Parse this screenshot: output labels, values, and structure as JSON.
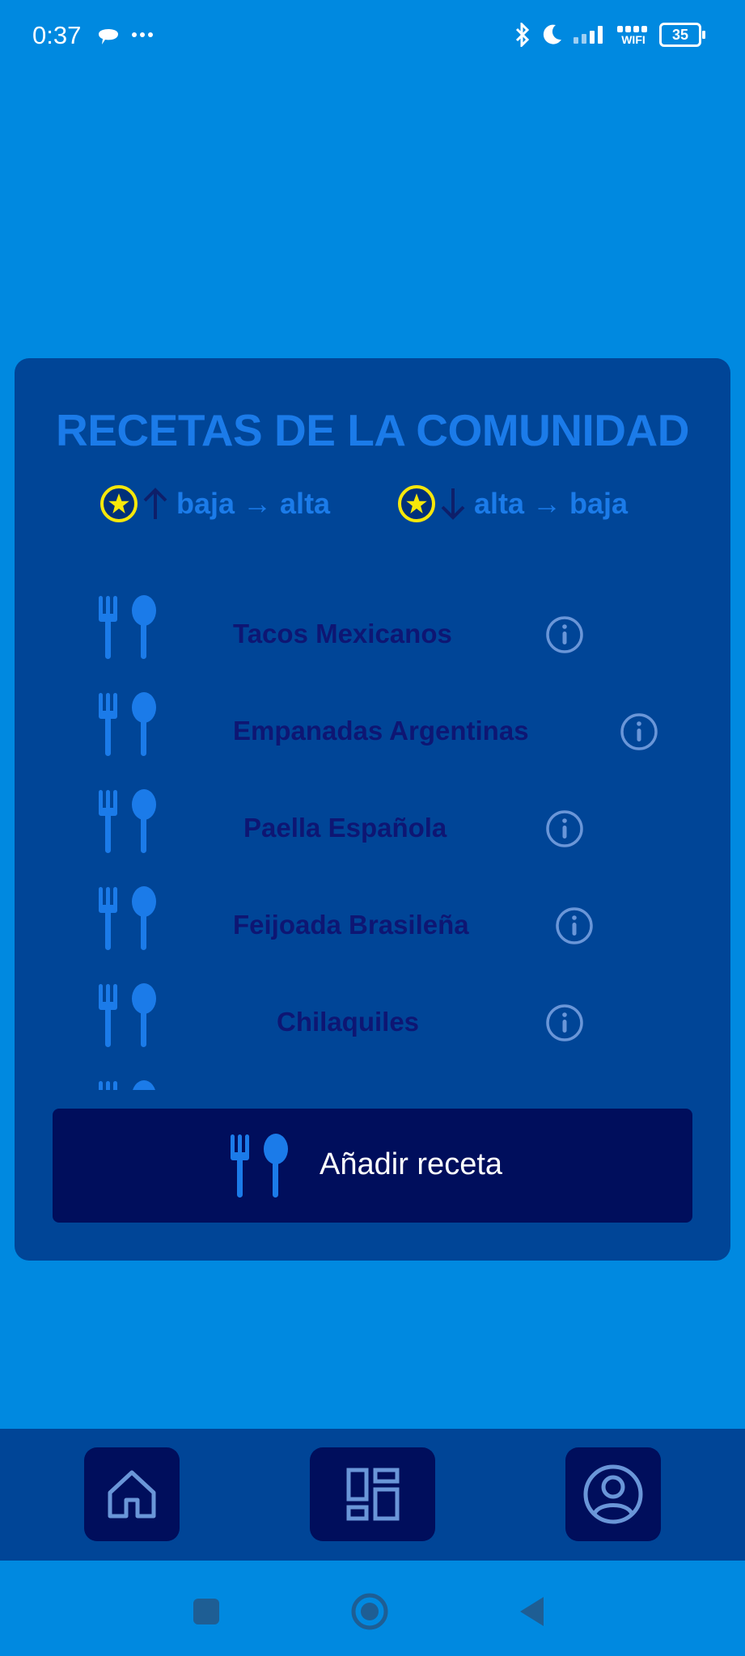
{
  "status_bar": {
    "time": "0:37",
    "battery": "35",
    "wifi_label": "WIFI",
    "icons": [
      "chat-bubble-icon",
      "more-dots-icon",
      "bluetooth-icon",
      "moon-icon",
      "signal-icon",
      "wifi-icon",
      "battery-icon"
    ]
  },
  "card": {
    "title": "RECETAS DE LA COMUNIDAD",
    "sort_ascending_label": "baja → alta",
    "sort_descending_label": "alta → baja"
  },
  "recipes": [
    {
      "name": "Tacos Mexicanos"
    },
    {
      "name": "Empanadas Argentinas"
    },
    {
      "name": "Paella Española"
    },
    {
      "name": "Feijoada Brasileña"
    },
    {
      "name": "Chilaquiles"
    }
  ],
  "add_button": {
    "label": "Añadir receta"
  },
  "bottom_nav": {
    "items": [
      "home-icon",
      "dashboard-icon",
      "profile-icon"
    ]
  },
  "system_nav": {
    "items": [
      "recents-button",
      "home-button",
      "back-button"
    ]
  },
  "colors": {
    "background": "#0089e0",
    "card": "#004597",
    "accent_text": "#1b7be9",
    "dark_button": "#000e5c",
    "recipe_text": "#0e1673",
    "star": "#f6e70a"
  }
}
